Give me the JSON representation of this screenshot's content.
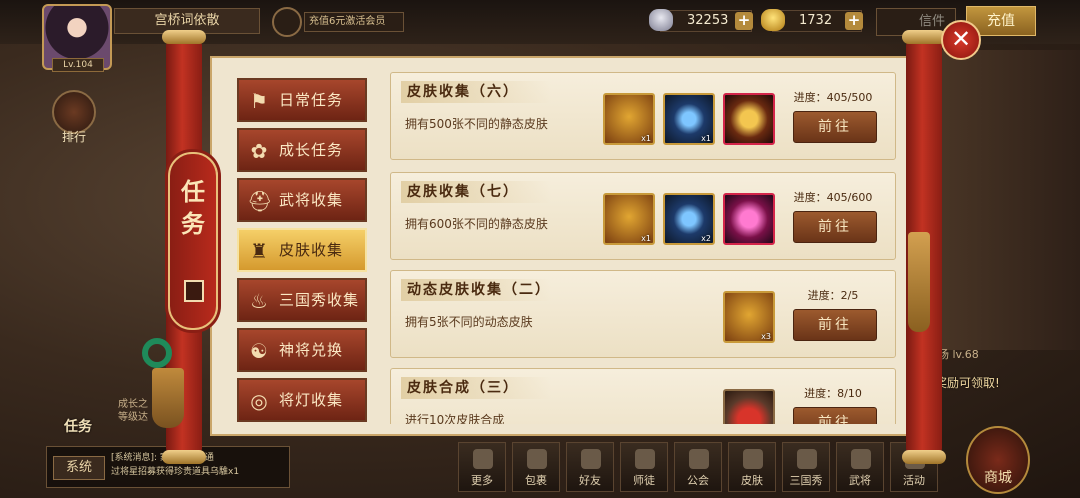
{
  "hud": {
    "player_name": "宫桥词依散",
    "level": "Lv.104",
    "vip_promo": "充值6元激活会员",
    "silver": "32253",
    "gold": "1732",
    "mail_label": "信件",
    "recharge_label": "充值",
    "rank_label": "排行",
    "task_label": "任务",
    "growth_text": "成长之\n等级达",
    "right_tag": "场 lv.68",
    "right_claim": "奖励可领取!"
  },
  "chat": {
    "system_label": "系统",
    "message_line1": "[系统消息]:      家玩家逢播通",
    "message_line2": "过将星招募获得珍贵道具乌騅x1"
  },
  "bottom_bar": [
    {
      "label": "更多"
    },
    {
      "label": "包裹"
    },
    {
      "label": "好友"
    },
    {
      "label": "师徒"
    },
    {
      "label": "公会"
    },
    {
      "label": "皮肤"
    },
    {
      "label": "三国秀"
    },
    {
      "label": "武将"
    },
    {
      "label": "活动"
    }
  ],
  "shop_label": "商城",
  "panel": {
    "title_char1": "任",
    "title_char2": "务",
    "close_symbol": "✕"
  },
  "tabs": [
    {
      "label": "日常任务",
      "icon": "flag-icon",
      "glyph": "⚑",
      "active": false
    },
    {
      "label": "成长任务",
      "icon": "lotus-icon",
      "glyph": "✿",
      "active": false
    },
    {
      "label": "武将收集",
      "icon": "helmet-icon",
      "glyph": "⛑",
      "active": false
    },
    {
      "label": "皮肤收集",
      "icon": "armor-icon",
      "glyph": "♜",
      "active": true
    },
    {
      "label": "三国秀收集",
      "icon": "flame-icon",
      "glyph": "♨",
      "active": false
    },
    {
      "label": "神将兑换",
      "icon": "general-icon",
      "glyph": "☯",
      "active": false
    },
    {
      "label": "将灯收集",
      "icon": "lantern-icon",
      "glyph": "◎",
      "active": false
    }
  ],
  "tasks": [
    {
      "title": "皮肤收集（六）",
      "desc": "拥有500张不同的静态皮肤",
      "progress": "进度：405/500",
      "button": "前往",
      "rewards": [
        {
          "type": "scroll",
          "count": "x1"
        },
        {
          "type": "blue-flame",
          "count": "x1"
        },
        {
          "type": "gold-armor",
          "count": ""
        }
      ]
    },
    {
      "title": "皮肤收集（七）",
      "desc": "拥有600张不同的静态皮肤",
      "progress": "进度：405/600",
      "button": "前往",
      "rewards": [
        {
          "type": "scroll",
          "count": "x1"
        },
        {
          "type": "blue-flame",
          "count": "x2"
        },
        {
          "type": "pink-armor",
          "count": ""
        }
      ]
    },
    {
      "title": "动态皮肤收集（二）",
      "desc": "拥有5张不同的动态皮肤",
      "progress": "进度：2/5",
      "button": "前往",
      "rewards": [
        {
          "type": "scroll",
          "count": "x3"
        }
      ]
    },
    {
      "title": "皮肤合成（三）",
      "desc": "进行10次皮肤合成",
      "progress": "进度：8/10",
      "button": "前往",
      "rewards": [
        {
          "type": "cup",
          "count": ""
        }
      ]
    }
  ]
}
